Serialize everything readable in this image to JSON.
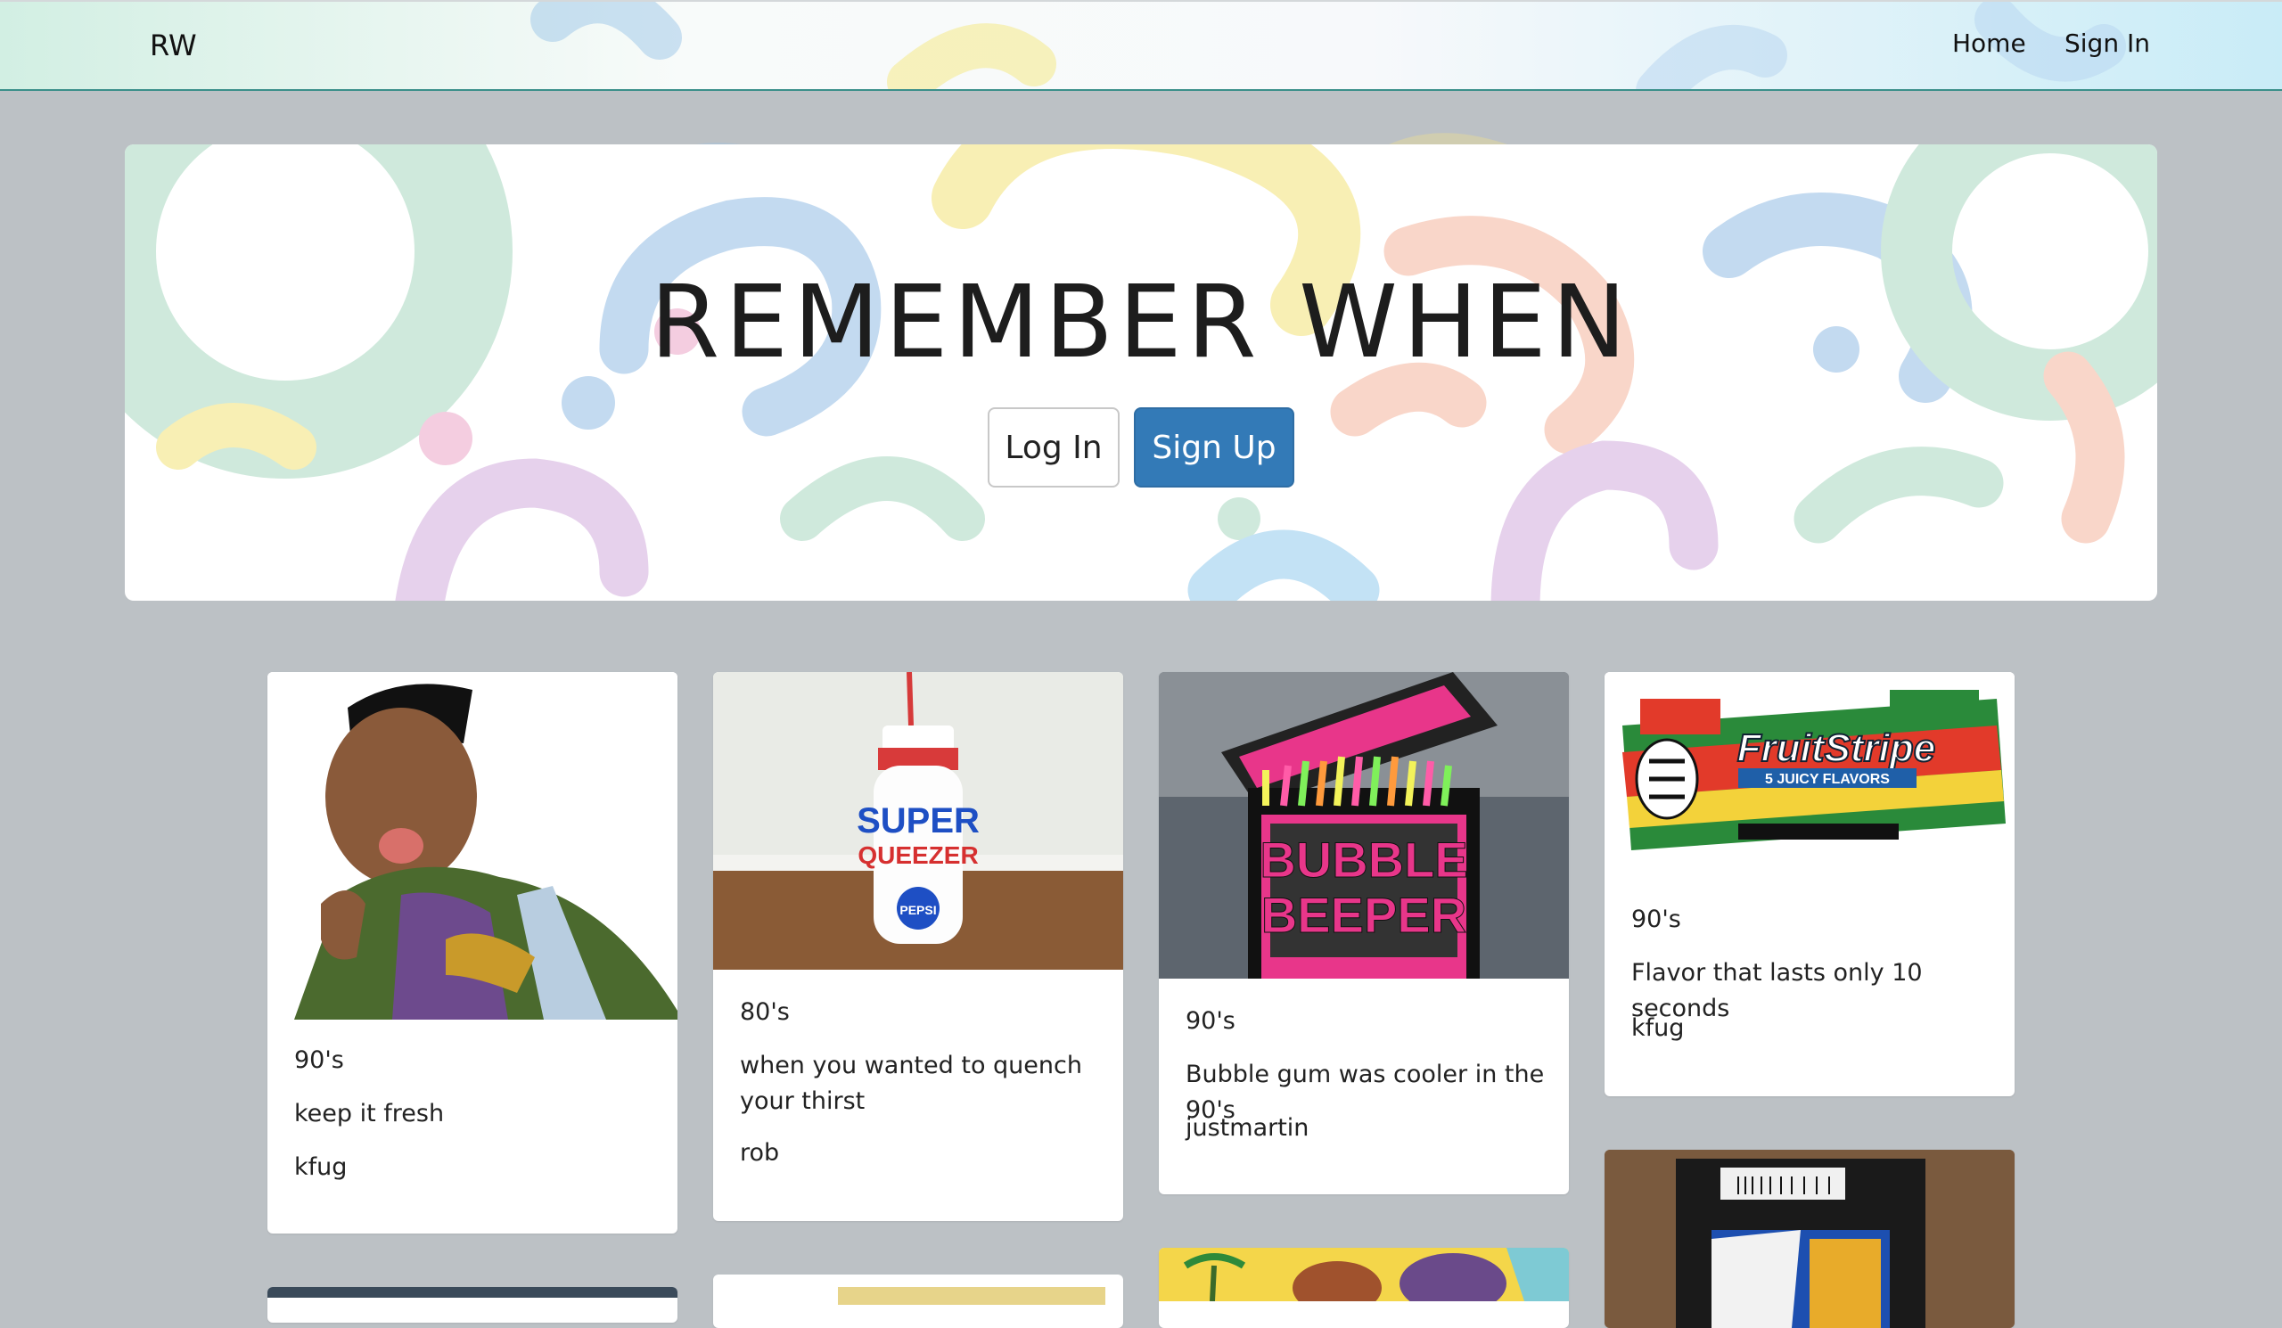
{
  "navbar": {
    "brand": "RW",
    "links": [
      "Home",
      "Sign In"
    ]
  },
  "hero": {
    "title": "REMEMBER WHEN",
    "login_label": "Log In",
    "signup_label": "Sign Up"
  },
  "cards": [
    {
      "image": "fresh-prince-photo",
      "decade": "90's",
      "description": "keep it fresh",
      "author": "kfug"
    },
    {
      "image": "super-squeezer-bottle-photo",
      "decade": "80's",
      "description": "when you wanted to quench your thirst",
      "author": "rob"
    },
    {
      "image": "bubble-beeper-gum-photo",
      "decade": "90's",
      "description": "Bubble gum was cooler in the 90's",
      "author": "justmartin"
    },
    {
      "image": "fruit-stripe-gum-photo",
      "decade": "90's",
      "description": "Flavor that lasts only 10 seconds",
      "author": "kfug"
    }
  ],
  "image_text": {
    "super": "SUPER",
    "squeezer": "QUEEZER",
    "pepsi": "PEPSI",
    "bubble": "BUBBLE",
    "beeper": "BEEPER",
    "fruit_stripe": "FruitStripe",
    "juicy": "5 JUICY FLAVORS"
  },
  "colors": {
    "primary_button": "#337ab7",
    "page_background": "#bcc1c5",
    "navbar_border": "#3a8f8a"
  }
}
